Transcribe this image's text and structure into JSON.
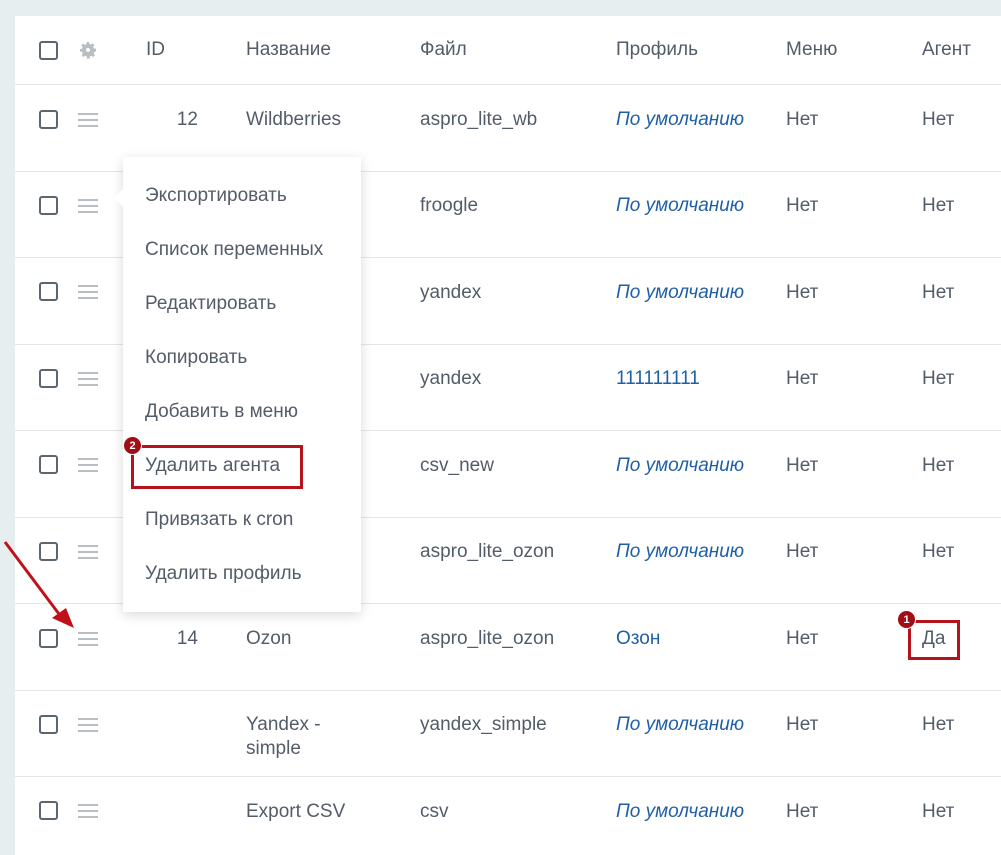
{
  "header": {
    "id": "ID",
    "name": "Название",
    "file": "Файл",
    "profile": "Профиль",
    "menu": "Меню",
    "agent": "Агент"
  },
  "rows": [
    {
      "id": "12",
      "name": "Wildberries",
      "file": "aspro_lite_wb",
      "profile": "По умолчанию",
      "menu": "Нет",
      "agent": "Нет"
    },
    {
      "id": "",
      "name": "",
      "file": "froogle",
      "profile": "По умолчанию",
      "menu": "Нет",
      "agent": "Нет"
    },
    {
      "id": "",
      "name": "",
      "file": "yandex",
      "profile": "По умолчанию",
      "menu": "Нет",
      "agent": "Нет"
    },
    {
      "id": "",
      "name": "",
      "file": "yandex",
      "profile": "111111111",
      "menu": "Нет",
      "agent": "Нет"
    },
    {
      "id": "",
      "name": "",
      "file": "csv_new",
      "profile": "По умолчанию",
      "menu": "Нет",
      "agent": "Нет"
    },
    {
      "id": "",
      "name": "",
      "file": "aspro_lite_ozon",
      "profile": "По умолчанию",
      "menu": "Нет",
      "agent": "Нет"
    },
    {
      "id": "14",
      "name": "Ozon",
      "file": "aspro_lite_ozon",
      "profile": "Озон",
      "menu": "Нет",
      "agent": "Да"
    },
    {
      "id": "",
      "name": "Yandex - simple",
      "file": "yandex_simple",
      "profile": "По умолчанию",
      "menu": "Нет",
      "agent": "Нет"
    },
    {
      "id": "",
      "name": "Export CSV",
      "file": "csv",
      "profile": "По умолчанию",
      "menu": "Нет",
      "agent": "Нет"
    }
  ],
  "context_menu": {
    "items": [
      "Экспортировать",
      "Список переменных",
      "Редактировать",
      "Копировать",
      "Добавить в меню",
      "Удалить агента",
      "Привязать к cron",
      "Удалить профиль"
    ]
  },
  "annotations": {
    "badge_1": "1",
    "badge_2": "2",
    "color": "#b5121b"
  }
}
